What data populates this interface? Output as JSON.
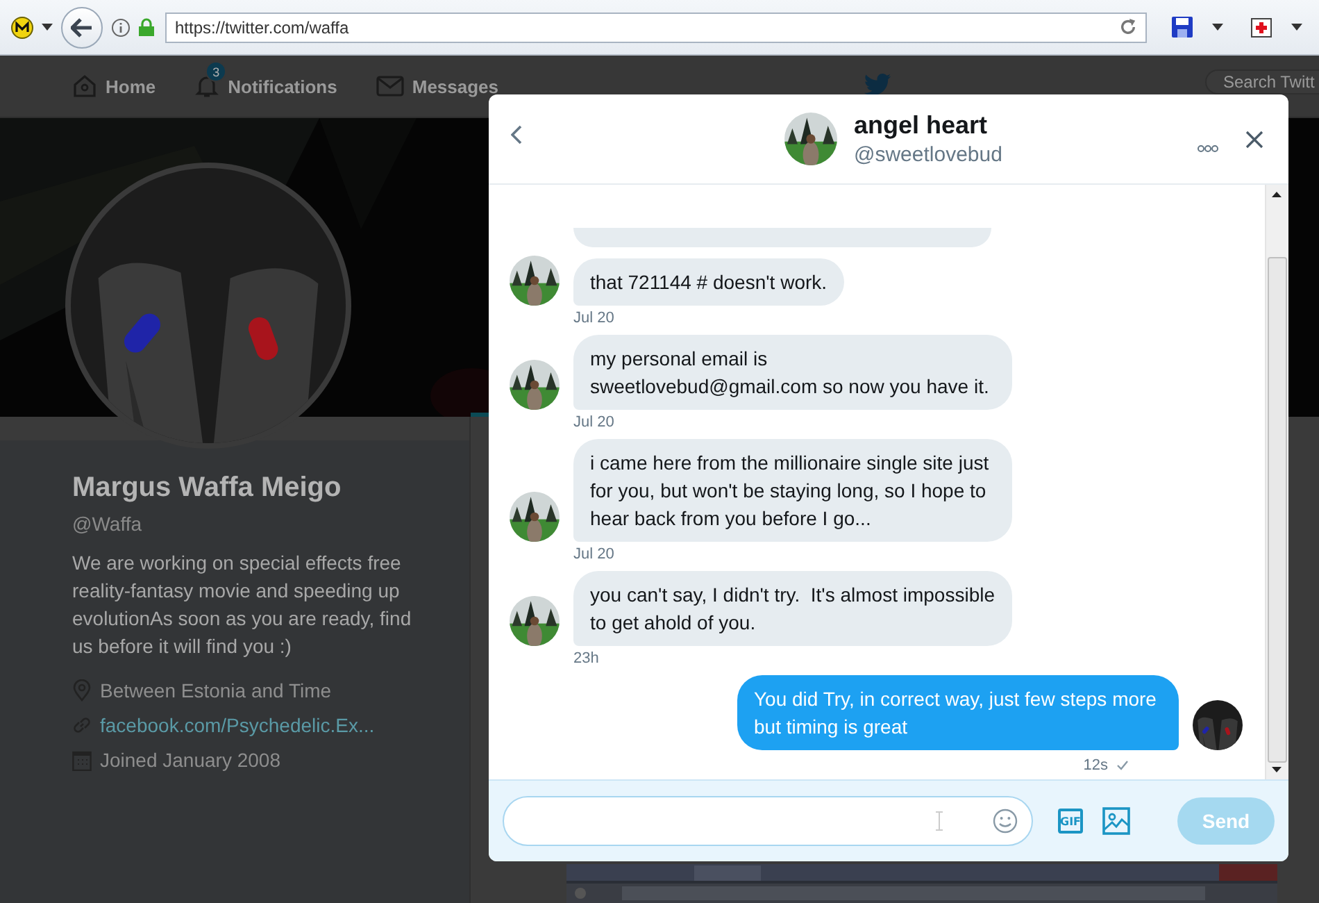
{
  "browser": {
    "url": "https://twitter.com/waffa"
  },
  "nav": {
    "items": [
      {
        "kind": "home",
        "label": "Home"
      },
      {
        "kind": "notifications",
        "label": "Notifications",
        "badge": "3"
      },
      {
        "kind": "messages",
        "label": "Messages"
      }
    ],
    "search": {
      "placeholder": "Search Twitt"
    }
  },
  "profile": {
    "name": "Margus Waffa Meigo",
    "handle": "@Waffa",
    "bio": "We are working on special effects free reality-fantasy movie and speeding up evolutionAs soon as you are ready, find us before it will find you :)",
    "location": "Between Estonia and Time",
    "link": "facebook.com/Psychedelic.Ex...",
    "joined": "Joined January 2008"
  },
  "conversation": {
    "name": "angel heart",
    "handle": "@sweetlovebud",
    "messages": [
      {
        "kind": "received",
        "text": "that 721144 # doesn't work.",
        "time": "Jul 20"
      },
      {
        "kind": "received",
        "text": "my personal email is sweetlovebud@gmail.com so now you have it.",
        "time": "Jul 20"
      },
      {
        "kind": "received",
        "text": "i came here from the millionaire single site just for you, but won't be staying long, so I hope to hear back from you before I go...",
        "time": "Jul 20"
      },
      {
        "kind": "received",
        "text": "you can't say, I didn't try.  It's almost impossible to get ahold of you.",
        "time": "23h"
      },
      {
        "kind": "sent",
        "text": "You did Try, in correct way, just few steps more but timing is great",
        "time": "12s",
        "read": true
      }
    ],
    "composer": {
      "gif_label": "GIF",
      "send_label": "Send",
      "send_disabled": true
    }
  }
}
